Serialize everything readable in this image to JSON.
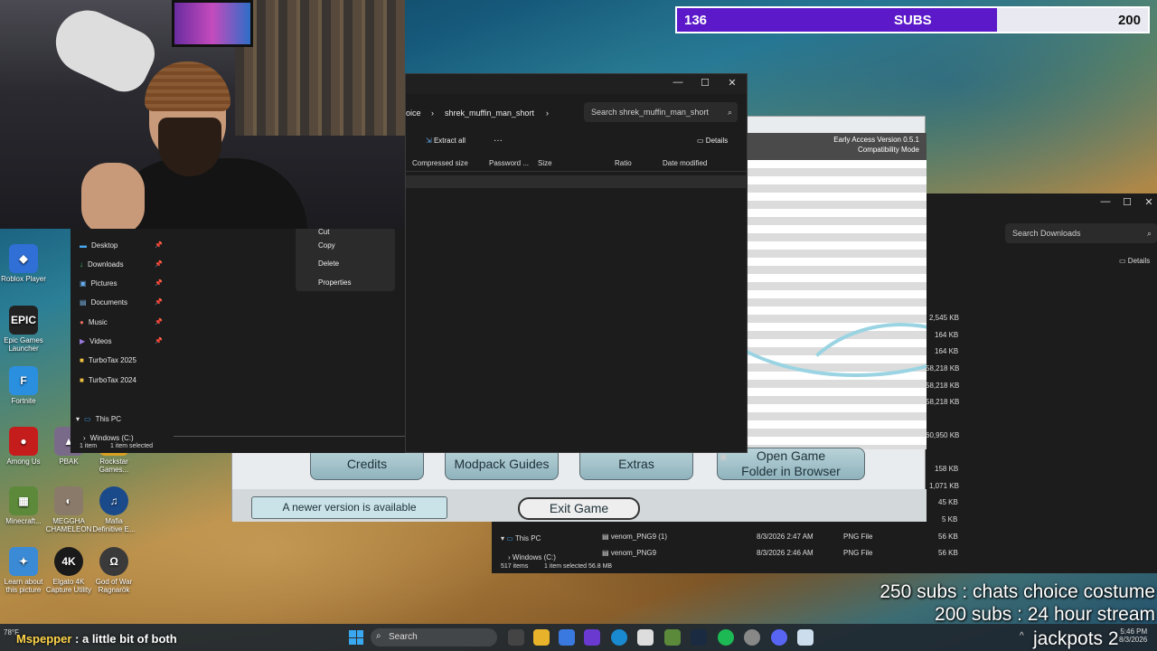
{
  "subs_goal": {
    "current": "136",
    "label": "SUBS",
    "target": "200",
    "progress": 0.68,
    "fill_color": "#5b19c9"
  },
  "explorer_top": {
    "breadcrumb_prev": "oice",
    "breadcrumb_current": "shrek_muffin_man_short",
    "search_placeholder": "Search shrek_muffin_man_short",
    "extract_all": "Extract all",
    "more": "···",
    "details": "Details",
    "columns": [
      "Compressed size",
      "Password ...",
      "Size",
      "Ratio",
      "Date modified"
    ],
    "status_count": "1 item",
    "status_selected": "1 item selected"
  },
  "nav_pane": {
    "items": [
      {
        "label": "Desktop",
        "icon": "desktop-icon"
      },
      {
        "label": "Downloads",
        "icon": "download-icon"
      },
      {
        "label": "Pictures",
        "icon": "pictures-icon"
      },
      {
        "label": "Documents",
        "icon": "documents-icon"
      },
      {
        "label": "Music",
        "icon": "music-icon"
      },
      {
        "label": "Videos",
        "icon": "videos-icon"
      },
      {
        "label": "TurboTax 2025",
        "icon": "folder-icon"
      },
      {
        "label": "TurboTax 2024",
        "icon": "folder-icon"
      }
    ],
    "this_pc": "This PC",
    "windows_drive": "Windows (C:)"
  },
  "context_menu": {
    "items": [
      "Cut",
      "Copy",
      "Delete",
      "Properties"
    ]
  },
  "launcher": {
    "version_line1": "Early Access Version 0.5.1",
    "version_line2": "Compatibility Mode",
    "buttons": {
      "credits": "Credits",
      "guides": "Modpack Guides",
      "extras": "Extras",
      "open_folder_1": "Open Game",
      "open_folder_2": "Folder in Browser",
      "exit": "Exit Game"
    },
    "update_notice": "A newer version is available"
  },
  "explorer_bottom": {
    "search_placeholder": "Search Downloads",
    "details": "Details",
    "sizes": [
      "2,545 KB",
      "164 KB",
      "164 KB",
      "58,218 KB",
      "58,218 KB",
      "58,218 KB",
      "60,950 KB",
      "158 KB",
      "1,071 KB",
      "45 KB",
      "5 KB"
    ],
    "this_pc": "This PC",
    "windows_drive": "Windows (C:)",
    "files": [
      {
        "name": "venom_PNG9 (1)",
        "date": "8/3/2026 2:47 AM",
        "type": "PNG File",
        "size": "56 KB"
      },
      {
        "name": "venom_PNG9",
        "date": "8/3/2026 2:46 AM",
        "type": "PNG File",
        "size": "56 KB"
      }
    ],
    "status_count": "517 items",
    "status_selected": "1 item selected  56.8 MB"
  },
  "desktop_icons": [
    {
      "label": "Roblox Player",
      "color": "#2f6fd6"
    },
    {
      "label": "Epic Games Launcher",
      "color": "#222222"
    },
    {
      "label": "Fortnite",
      "color": "#2b8fe0"
    },
    {
      "label": "Among Us",
      "color": "#c51c1c"
    },
    {
      "label": "Minecraft...",
      "color": "#5c8a3a"
    },
    {
      "label": "Learn about this picture",
      "color": "#3a8ad6"
    },
    {
      "label": "PBAK",
      "color": "#7a6a8a"
    },
    {
      "label": "MEGGHA CHAMELEON",
      "color": "#8a7a6a"
    },
    {
      "label": "Elgato 4K Capture Utility",
      "color": "#1a1a1a"
    },
    {
      "label": "Rockstar Games...",
      "color": "#d8a020"
    },
    {
      "label": "Mafia Definitive E...",
      "color": "#1a4a8a"
    },
    {
      "label": "God of War Ragnarök",
      "color": "#3a3a3a"
    }
  ],
  "overlay": {
    "goal1": "250 subs : chats choice costume",
    "goal2": "200 subs : 24 hour stream"
  },
  "taskbar": {
    "weather": "78°F",
    "chat_user": "Mspepper",
    "chat_msg": ": a little bit of both",
    "search": "Search",
    "jackpots": "jackpots 2",
    "clock_time": "5:46 PM",
    "clock_date": "8/3/2026"
  }
}
